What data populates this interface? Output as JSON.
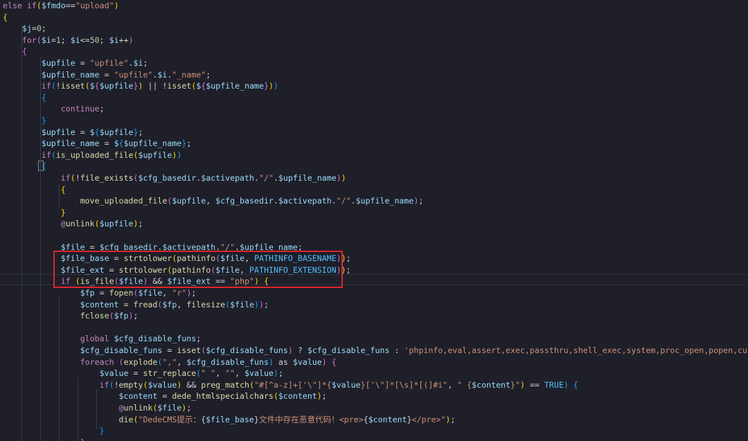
{
  "editor": {
    "lines": [
      [
        [
          "kw",
          "else "
        ],
        [
          "kw",
          "if"
        ],
        [
          "b1",
          "("
        ],
        [
          "v",
          "$fmdo"
        ],
        [
          "p",
          "=="
        ],
        [
          "s",
          "\"upload\""
        ],
        [
          "b1",
          ")"
        ]
      ],
      [
        [
          "b1",
          "{"
        ]
      ],
      [
        [
          "p",
          "    "
        ],
        [
          "v",
          "$j"
        ],
        [
          "p",
          "="
        ],
        [
          "n",
          "0"
        ],
        [
          "p",
          ";"
        ]
      ],
      [
        [
          "p",
          "    "
        ],
        [
          "kw",
          "for"
        ],
        [
          "b2",
          "("
        ],
        [
          "v",
          "$i"
        ],
        [
          "p",
          "="
        ],
        [
          "n",
          "1"
        ],
        [
          "p",
          "; "
        ],
        [
          "v",
          "$i"
        ],
        [
          "p",
          "<="
        ],
        [
          "n",
          "50"
        ],
        [
          "p",
          "; "
        ],
        [
          "v",
          "$i"
        ],
        [
          "p",
          "++"
        ],
        [
          "b2",
          ")"
        ]
      ],
      [
        [
          "p",
          "    "
        ],
        [
          "b2",
          "{"
        ]
      ],
      [
        [
          "p",
          "        "
        ],
        [
          "v",
          "$upfile"
        ],
        [
          "p",
          " = "
        ],
        [
          "s",
          "\"upfile\""
        ],
        [
          "p",
          "."
        ],
        [
          "v",
          "$i"
        ],
        [
          "p",
          ";"
        ]
      ],
      [
        [
          "p",
          "        "
        ],
        [
          "v",
          "$upfile_name"
        ],
        [
          "p",
          " = "
        ],
        [
          "s",
          "\"upfile\""
        ],
        [
          "p",
          "."
        ],
        [
          "v",
          "$i"
        ],
        [
          "p",
          "."
        ],
        [
          "s",
          "\"_name\""
        ],
        [
          "p",
          ";"
        ]
      ],
      [
        [
          "p",
          "        "
        ],
        [
          "kw",
          "if"
        ],
        [
          "b3",
          "("
        ],
        [
          "p",
          "!"
        ],
        [
          "fn",
          "isset"
        ],
        [
          "b1",
          "("
        ],
        [
          "v",
          "$"
        ],
        [
          "b2",
          "{"
        ],
        [
          "v",
          "$upfile"
        ],
        [
          "b2",
          "}"
        ],
        [
          "b1",
          ")"
        ],
        [
          "p",
          " || !"
        ],
        [
          "fn",
          "isset"
        ],
        [
          "b1",
          "("
        ],
        [
          "v",
          "$"
        ],
        [
          "b2",
          "{"
        ],
        [
          "v",
          "$upfile_name"
        ],
        [
          "b2",
          "}"
        ],
        [
          "b1",
          ")"
        ],
        [
          "b3",
          ")"
        ]
      ],
      [
        [
          "p",
          "        "
        ],
        [
          "b3",
          "{"
        ]
      ],
      [
        [
          "p",
          "            "
        ],
        [
          "kw",
          "continue"
        ],
        [
          "p",
          ";"
        ]
      ],
      [
        [
          "p",
          "        "
        ],
        [
          "b3",
          "}"
        ]
      ],
      [
        [
          "p",
          "        "
        ],
        [
          "v",
          "$upfile"
        ],
        [
          "p",
          " = "
        ],
        [
          "v",
          "$"
        ],
        [
          "b3",
          "{"
        ],
        [
          "v",
          "$upfile"
        ],
        [
          "b3",
          "}"
        ],
        [
          "p",
          ";"
        ]
      ],
      [
        [
          "p",
          "        "
        ],
        [
          "v",
          "$upfile_name"
        ],
        [
          "p",
          " = "
        ],
        [
          "v",
          "$"
        ],
        [
          "b3",
          "{"
        ],
        [
          "v",
          "$upfile_name"
        ],
        [
          "b3",
          "}"
        ],
        [
          "p",
          ";"
        ]
      ],
      [
        [
          "p",
          "        "
        ],
        [
          "kw",
          "if"
        ],
        [
          "b3",
          "("
        ],
        [
          "fn",
          "is_uploaded_file"
        ],
        [
          "b1",
          "("
        ],
        [
          "v",
          "$upfile"
        ],
        [
          "b1",
          ")"
        ],
        [
          "b3",
          ")"
        ]
      ],
      [
        [
          "p",
          "        "
        ],
        [
          "b3",
          "{"
        ]
      ],
      [
        [
          "p",
          "            "
        ],
        [
          "kw",
          "if"
        ],
        [
          "b1",
          "("
        ],
        [
          "p",
          "!"
        ],
        [
          "fn",
          "file_exists"
        ],
        [
          "b2",
          "("
        ],
        [
          "v",
          "$cfg_basedir"
        ],
        [
          "p",
          "."
        ],
        [
          "v",
          "$activepath"
        ],
        [
          "p",
          "."
        ],
        [
          "s",
          "\"/\""
        ],
        [
          "p",
          "."
        ],
        [
          "v",
          "$upfile_name"
        ],
        [
          "b2",
          ")"
        ],
        [
          "b1",
          ")"
        ]
      ],
      [
        [
          "p",
          "            "
        ],
        [
          "b1",
          "{"
        ]
      ],
      [
        [
          "p",
          "                "
        ],
        [
          "fn",
          "move_uploaded_file"
        ],
        [
          "b2",
          "("
        ],
        [
          "v",
          "$upfile"
        ],
        [
          "p",
          ", "
        ],
        [
          "v",
          "$cfg_basedir"
        ],
        [
          "p",
          "."
        ],
        [
          "v",
          "$activepath"
        ],
        [
          "p",
          "."
        ],
        [
          "s",
          "\"/\""
        ],
        [
          "p",
          "."
        ],
        [
          "v",
          "$upfile_name"
        ],
        [
          "b2",
          ")"
        ],
        [
          "p",
          ";"
        ]
      ],
      [
        [
          "p",
          "            "
        ],
        [
          "b1",
          "}"
        ]
      ],
      [
        [
          "p",
          "            "
        ],
        [
          "kw",
          "@"
        ],
        [
          "fn",
          "unlink"
        ],
        [
          "b1",
          "("
        ],
        [
          "v",
          "$upfile"
        ],
        [
          "b1",
          ")"
        ],
        [
          "p",
          ";"
        ]
      ],
      [
        [
          "p",
          ""
        ]
      ],
      [
        [
          "p",
          "            "
        ],
        [
          "v",
          "$file"
        ],
        [
          "p",
          " = "
        ],
        [
          "v",
          "$cfg_basedir"
        ],
        [
          "p",
          "."
        ],
        [
          "v",
          "$activepath"
        ],
        [
          "p",
          "."
        ],
        [
          "s",
          "\"/\""
        ],
        [
          "p",
          "."
        ],
        [
          "v",
          "$upfile_name"
        ],
        [
          "p",
          ";"
        ]
      ],
      [
        [
          "p",
          "            "
        ],
        [
          "v",
          "$file_base"
        ],
        [
          "p",
          " = "
        ],
        [
          "fn",
          "strtolower"
        ],
        [
          "b1",
          "("
        ],
        [
          "fn",
          "pathinfo"
        ],
        [
          "b2",
          "("
        ],
        [
          "v",
          "$file"
        ],
        [
          "p",
          ", "
        ],
        [
          "c",
          "PATHINFO_BASENAME"
        ],
        [
          "b2",
          ")"
        ],
        [
          "b1",
          ")"
        ],
        [
          "p",
          ";"
        ]
      ],
      [
        [
          "p",
          "            "
        ],
        [
          "v",
          "$file_ext"
        ],
        [
          "p",
          " = "
        ],
        [
          "fn",
          "strtolower"
        ],
        [
          "b1",
          "("
        ],
        [
          "fn",
          "pathinfo"
        ],
        [
          "b2",
          "("
        ],
        [
          "v",
          "$file"
        ],
        [
          "p",
          ", "
        ],
        [
          "c",
          "PATHINFO_EXTENSION"
        ],
        [
          "b2",
          ")"
        ],
        [
          "b1",
          ")"
        ],
        [
          "p",
          ";"
        ]
      ],
      [
        [
          "p",
          "            "
        ],
        [
          "kw",
          "if"
        ],
        [
          "p",
          " "
        ],
        [
          "b1",
          "("
        ],
        [
          "fn",
          "is_file"
        ],
        [
          "b2",
          "("
        ],
        [
          "v",
          "$file"
        ],
        [
          "b2",
          ")"
        ],
        [
          "p",
          " && "
        ],
        [
          "v",
          "$file_ext"
        ],
        [
          "p",
          " == "
        ],
        [
          "s",
          "\"php\""
        ],
        [
          "b1",
          ")"
        ],
        [
          "p",
          " "
        ],
        [
          "b1",
          "{"
        ]
      ],
      [
        [
          "p",
          "                "
        ],
        [
          "v",
          "$fp"
        ],
        [
          "p",
          " = "
        ],
        [
          "fn",
          "fopen"
        ],
        [
          "b2",
          "("
        ],
        [
          "v",
          "$file"
        ],
        [
          "p",
          ", "
        ],
        [
          "s",
          "\"r\""
        ],
        [
          "b2",
          ")"
        ],
        [
          "p",
          ";"
        ]
      ],
      [
        [
          "p",
          "                "
        ],
        [
          "v",
          "$content"
        ],
        [
          "p",
          " = "
        ],
        [
          "fn",
          "fread"
        ],
        [
          "b2",
          "("
        ],
        [
          "v",
          "$fp"
        ],
        [
          "p",
          ", "
        ],
        [
          "fn",
          "filesize"
        ],
        [
          "b3",
          "("
        ],
        [
          "v",
          "$file"
        ],
        [
          "b3",
          ")"
        ],
        [
          "b2",
          ")"
        ],
        [
          "p",
          ";"
        ]
      ],
      [
        [
          "p",
          "                "
        ],
        [
          "fn",
          "fclose"
        ],
        [
          "b2",
          "("
        ],
        [
          "v",
          "$fp"
        ],
        [
          "b2",
          ")"
        ],
        [
          "p",
          ";"
        ]
      ],
      [
        [
          "p",
          ""
        ]
      ],
      [
        [
          "p",
          "                "
        ],
        [
          "kw",
          "global"
        ],
        [
          "p",
          " "
        ],
        [
          "v",
          "$cfg_disable_funs"
        ],
        [
          "p",
          ";"
        ]
      ],
      [
        [
          "p",
          "                "
        ],
        [
          "v",
          "$cfg_disable_funs"
        ],
        [
          "p",
          " = "
        ],
        [
          "fn",
          "isset"
        ],
        [
          "b2",
          "("
        ],
        [
          "v",
          "$cfg_disable_funs"
        ],
        [
          "b2",
          ")"
        ],
        [
          "p",
          " ? "
        ],
        [
          "v",
          "$cfg_disable_funs"
        ],
        [
          "p",
          " : "
        ],
        [
          "s",
          "'phpinfo,eval,assert,exec,passthru,shell_exec,system,proc_open,popen,curl_exec"
        ]
      ],
      [
        [
          "p",
          "                "
        ],
        [
          "kw",
          "foreach"
        ],
        [
          "p",
          " "
        ],
        [
          "b2",
          "("
        ],
        [
          "fn",
          "explode"
        ],
        [
          "b3",
          "("
        ],
        [
          "s",
          "\",\""
        ],
        [
          "p",
          ", "
        ],
        [
          "v",
          "$cfg_disable_funs"
        ],
        [
          "b3",
          ")"
        ],
        [
          "p",
          " as "
        ],
        [
          "v",
          "$value"
        ],
        [
          "b2",
          ")"
        ],
        [
          "p",
          " "
        ],
        [
          "b2",
          "{"
        ]
      ],
      [
        [
          "p",
          "                    "
        ],
        [
          "v",
          "$value"
        ],
        [
          "p",
          " = "
        ],
        [
          "fn",
          "str_replace"
        ],
        [
          "b3",
          "("
        ],
        [
          "s",
          "\" \""
        ],
        [
          "p",
          ", "
        ],
        [
          "s",
          "\"\""
        ],
        [
          "p",
          ", "
        ],
        [
          "v",
          "$value"
        ],
        [
          "b3",
          ")"
        ],
        [
          "p",
          ";"
        ]
      ],
      [
        [
          "p",
          "                    "
        ],
        [
          "kw",
          "if"
        ],
        [
          "b3",
          "("
        ],
        [
          "p",
          "!"
        ],
        [
          "fn",
          "empty"
        ],
        [
          "b1",
          "("
        ],
        [
          "v",
          "$value"
        ],
        [
          "b1",
          ")"
        ],
        [
          "p",
          " && "
        ],
        [
          "fn",
          "preg_match"
        ],
        [
          "b1",
          "("
        ],
        [
          "s",
          "\"#[^a-z]+['\\\"]*{"
        ],
        [
          "v",
          "$value"
        ],
        [
          "s",
          "}['\\\"]*[\\s]*[(]#i\""
        ],
        [
          "p",
          ", "
        ],
        [
          "s",
          "\" {"
        ],
        [
          "v",
          "$content"
        ],
        [
          "s",
          "}\""
        ],
        [
          "b1",
          ")"
        ],
        [
          "p",
          " == "
        ],
        [
          "c",
          "TRUE"
        ],
        [
          "b3",
          ")"
        ],
        [
          "p",
          " "
        ],
        [
          "b3",
          "{"
        ]
      ],
      [
        [
          "p",
          "                        "
        ],
        [
          "v",
          "$content"
        ],
        [
          "p",
          " = "
        ],
        [
          "fn",
          "dede_htmlspecialchars"
        ],
        [
          "b1",
          "("
        ],
        [
          "v",
          "$content"
        ],
        [
          "b1",
          ")"
        ],
        [
          "p",
          ";"
        ]
      ],
      [
        [
          "p",
          "                        "
        ],
        [
          "kw",
          "@"
        ],
        [
          "fn",
          "unlink"
        ],
        [
          "b1",
          "("
        ],
        [
          "v",
          "$file"
        ],
        [
          "b1",
          ")"
        ],
        [
          "p",
          ";"
        ]
      ],
      [
        [
          "p",
          "                        "
        ],
        [
          "fn",
          "die"
        ],
        [
          "b1",
          "("
        ],
        [
          "s",
          "\"DedeCMS提示："
        ],
        [
          "p",
          "{"
        ],
        [
          "v",
          "$file_base"
        ],
        [
          "p",
          "}"
        ],
        [
          "s",
          "文件中存在恶意代码！<pre>"
        ],
        [
          "p",
          "{"
        ],
        [
          "v",
          "$content"
        ],
        [
          "p",
          "}"
        ],
        [
          "s",
          "</pre>\""
        ],
        [
          "b1",
          ")"
        ],
        [
          "p",
          ";"
        ]
      ],
      [
        [
          "p",
          "                    "
        ],
        [
          "b3",
          "}"
        ]
      ],
      [
        [
          "p",
          "                "
        ],
        [
          "b2",
          "}"
        ]
      ]
    ]
  }
}
